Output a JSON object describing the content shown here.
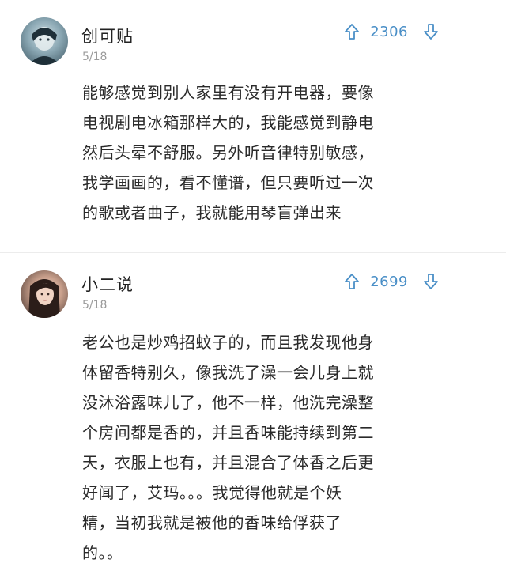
{
  "comments": [
    {
      "username": "创可贴",
      "date": "5/18",
      "votes": "2306",
      "text": "能够感觉到别人家里有没有开电器，要像\n电视剧电冰箱那样大的，我能感觉到静电\n然后头晕不舒服。另外听音律特别敏感，\n我学画画的，看不懂谱，但只要听过一次\n的歌或者曲子，我就能用琴盲弹出来"
    },
    {
      "username": "小二说",
      "date": "5/18",
      "votes": "2699",
      "text": "老公也是炒鸡招蚊子的，而且我发现他身\n体留香特别久，像我洗了澡一会儿身上就\n没沐浴露味儿了，他不一样，他洗完澡整\n个房间都是香的，并且香味能持续到第二\n天，衣服上也有，并且混合了体香之后更\n好闻了，艾玛。。。我觉得他就是个妖\n精，当初我就是被他的香味给俘获了\n的。。"
    }
  ],
  "icons": {
    "upvote": "arrow-up-icon",
    "downvote": "arrow-down-icon"
  },
  "colors": {
    "vote": "#4a8fc7",
    "text": "#2a2a2a",
    "date": "#9a9a9a"
  }
}
